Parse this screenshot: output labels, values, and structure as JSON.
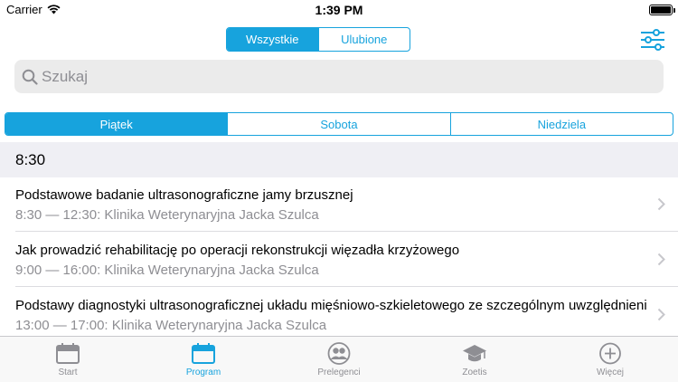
{
  "status_bar": {
    "carrier": "Carrier",
    "time": "1:39 PM"
  },
  "top_segment": {
    "items": [
      "Wszystkie",
      "Ulubione"
    ],
    "selected": "Wszystkie"
  },
  "search": {
    "placeholder": "Szukaj"
  },
  "day_tabs": {
    "items": [
      "Piątek",
      "Sobota",
      "Niedziela"
    ],
    "selected": "Piątek"
  },
  "section": {
    "header": "8:30"
  },
  "events": [
    {
      "title": "Podstawowe badanie ultrasonograficzne jamy brzusznej",
      "subtitle": "8:30 — 12:30: Klinika Weterynaryjna Jacka Szulca"
    },
    {
      "title": "Jak prowadzić rehabilitację po operacji rekonstrukcji więzadła krzyżowego",
      "subtitle": "9:00 — 16:00: Klinika Weterynaryjna Jacka Szulca"
    },
    {
      "title": "Podstawy diagnostyki ultrasonograficznej układu mięśniowo-szkieletowego ze szczególnym uwzględnienie",
      "subtitle": "13:00 — 17:00: Klinika Weterynaryjna Jacka Szulca"
    }
  ],
  "tab_bar": {
    "items": [
      {
        "label": "Start",
        "icon": "calendar-icon"
      },
      {
        "label": "Program",
        "icon": "calendar-icon"
      },
      {
        "label": "Prelegenci",
        "icon": "people-icon"
      },
      {
        "label": "Zoetis",
        "icon": "graduation-cap-icon"
      },
      {
        "label": "Więcej",
        "icon": "plus-circle-icon"
      }
    ],
    "selected": "Program"
  },
  "colors": {
    "accent": "#17a3dd",
    "inactive": "#8e8e93",
    "section_bg": "#efeff4"
  }
}
